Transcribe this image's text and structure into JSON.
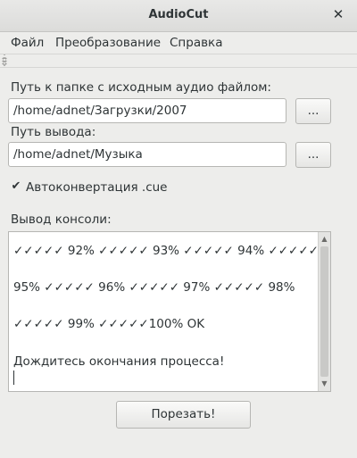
{
  "window": {
    "title": "AudioCut",
    "close_icon": "close-icon"
  },
  "menu": {
    "items": [
      {
        "label": "Файл"
      },
      {
        "label": "Преобразование"
      },
      {
        "label": "Справка"
      }
    ]
  },
  "source": {
    "label": "Путь к папке с исходным аудио файлом:",
    "value": "/home/adnet/Загрузки/2007",
    "browse_label": "..."
  },
  "output": {
    "label": "Путь вывода:",
    "value": "/home/adnet/Музыка",
    "browse_label": "..."
  },
  "autoconvert": {
    "label": "Автоконвертация .cue",
    "checked": true,
    "check_glyph": "✔"
  },
  "console": {
    "label": "Вывод консоли:",
    "lines": [
      "✓✓✓✓✓ 92% ✓✓✓✓✓ 93% ✓✓✓✓✓ 94% ✓✓✓✓✓",
      "95% ✓✓✓✓✓ 96% ✓✓✓✓✓ 97% ✓✓✓✓✓ 98%",
      "✓✓✓✓✓ 99% ✓✓✓✓✓100% OK",
      "Дождитесь окончания процесса!"
    ],
    "scroll_up_icon": "arrow-up-icon",
    "scroll_down_icon": "arrow-down-icon"
  },
  "cut_button": {
    "label": "Порезать!"
  }
}
